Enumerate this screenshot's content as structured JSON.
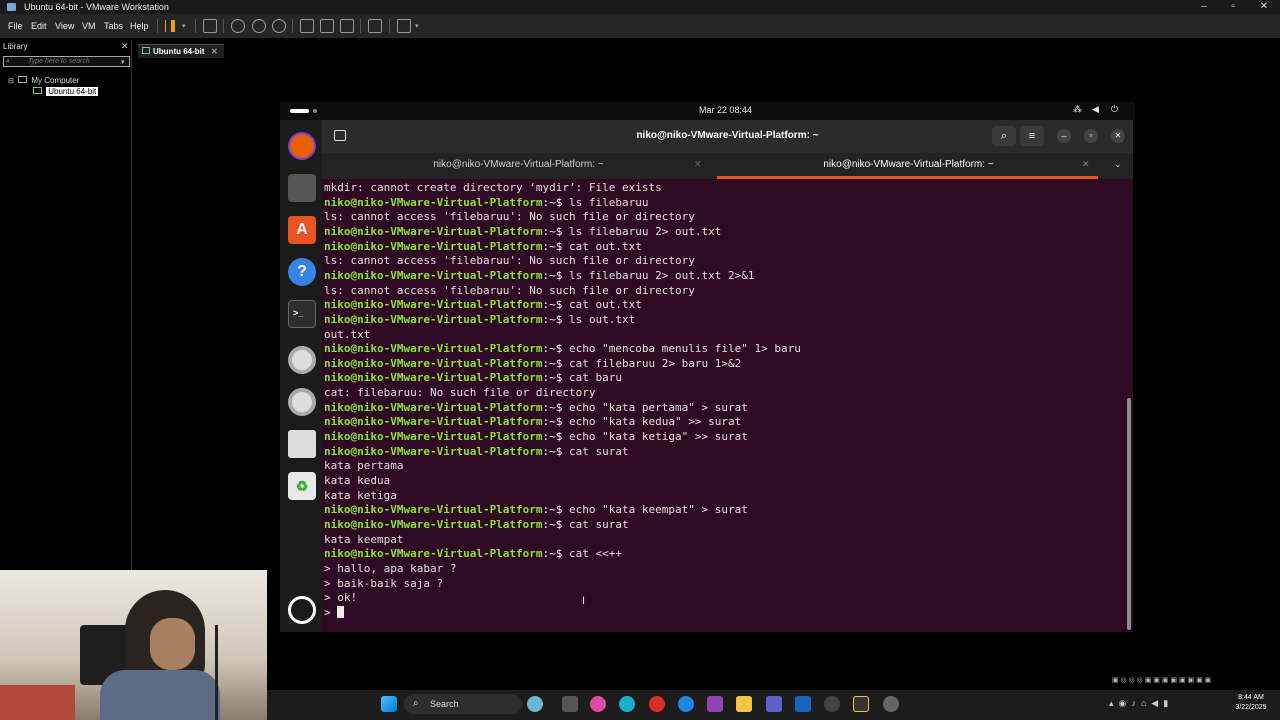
{
  "window": {
    "title": "Ubuntu 64-bit - VMware Workstation"
  },
  "menubar": {
    "items": [
      "File",
      "Edit",
      "View",
      "VM",
      "Tabs",
      "Help"
    ]
  },
  "library": {
    "title": "Library",
    "search_placeholder": "Type here to search",
    "root": "My Computer",
    "vm": "Ubuntu 64-bit"
  },
  "vm_tab": {
    "label": "Ubuntu 64-bit"
  },
  "gnome": {
    "datetime": "Mar 22  08:44"
  },
  "terminal": {
    "title": "niko@niko-VMware-Virtual-Platform: ~",
    "tabs": [
      {
        "label": "niko@niko-VMware-Virtual-Platform: ~",
        "active": false
      },
      {
        "label": "niko@niko-VMware-Virtual-Platform: ~",
        "active": true
      }
    ],
    "prompt": "niko@niko-VMware-Virtual-Platform",
    "lines": [
      {
        "type": "out",
        "text": "mkdir: cannot create directory ‘mydir’: File exists"
      },
      {
        "type": "cmd",
        "text": "ls filebaruu"
      },
      {
        "type": "out",
        "text": "ls: cannot access 'filebaruu': No such file or directory"
      },
      {
        "type": "cmd",
        "text": "ls filebaruu 2> out.txt"
      },
      {
        "type": "cmd",
        "text": "cat out.txt"
      },
      {
        "type": "out",
        "text": "ls: cannot access 'filebaruu': No such file or directory"
      },
      {
        "type": "cmd",
        "text": "ls filebaruu 2> out.txt 2>&1"
      },
      {
        "type": "out",
        "text": "ls: cannot access 'filebaruu': No such file or directory"
      },
      {
        "type": "cmd",
        "text": "cat out.txt"
      },
      {
        "type": "cmd",
        "text": "ls out.txt"
      },
      {
        "type": "out",
        "text": "out.txt"
      },
      {
        "type": "cmd",
        "text": "echo \"mencoba menulis file\" 1> baru"
      },
      {
        "type": "cmd",
        "text": "cat filebaruu 2> baru 1>&2"
      },
      {
        "type": "cmd",
        "text": "cat baru"
      },
      {
        "type": "out",
        "text": "cat: filebaruu: No such file or directory"
      },
      {
        "type": "cmd",
        "text": "echo \"kata pertama\" > surat"
      },
      {
        "type": "cmd",
        "text": "echo \"kata kedua\" >> surat"
      },
      {
        "type": "cmd",
        "text": "echo \"kata ketiga\" >> surat"
      },
      {
        "type": "cmd",
        "text": "cat surat"
      },
      {
        "type": "out",
        "text": "kata pertama"
      },
      {
        "type": "out",
        "text": "kata kedua"
      },
      {
        "type": "out",
        "text": "kata ketiga"
      },
      {
        "type": "cmd",
        "text": "echo \"kata keempat\" > surat"
      },
      {
        "type": "cmd",
        "text": "cat surat"
      },
      {
        "type": "out",
        "text": "kata keempat"
      },
      {
        "type": "cmd",
        "text": "cat <<++"
      },
      {
        "type": "out",
        "text": "> hallo, apa kabar ?"
      },
      {
        "type": "out",
        "text": "> baik-baik saja ?"
      },
      {
        "type": "out",
        "text": "> ok!"
      },
      {
        "type": "cursor",
        "text": "> "
      }
    ]
  },
  "taskbar": {
    "search_label": "Search",
    "time": "8:44 AM",
    "date": "3/22/2025"
  },
  "colors": {
    "terminal_bg": "#300a24",
    "prompt_green": "#8ae234",
    "accent_tab": "#e95420"
  }
}
